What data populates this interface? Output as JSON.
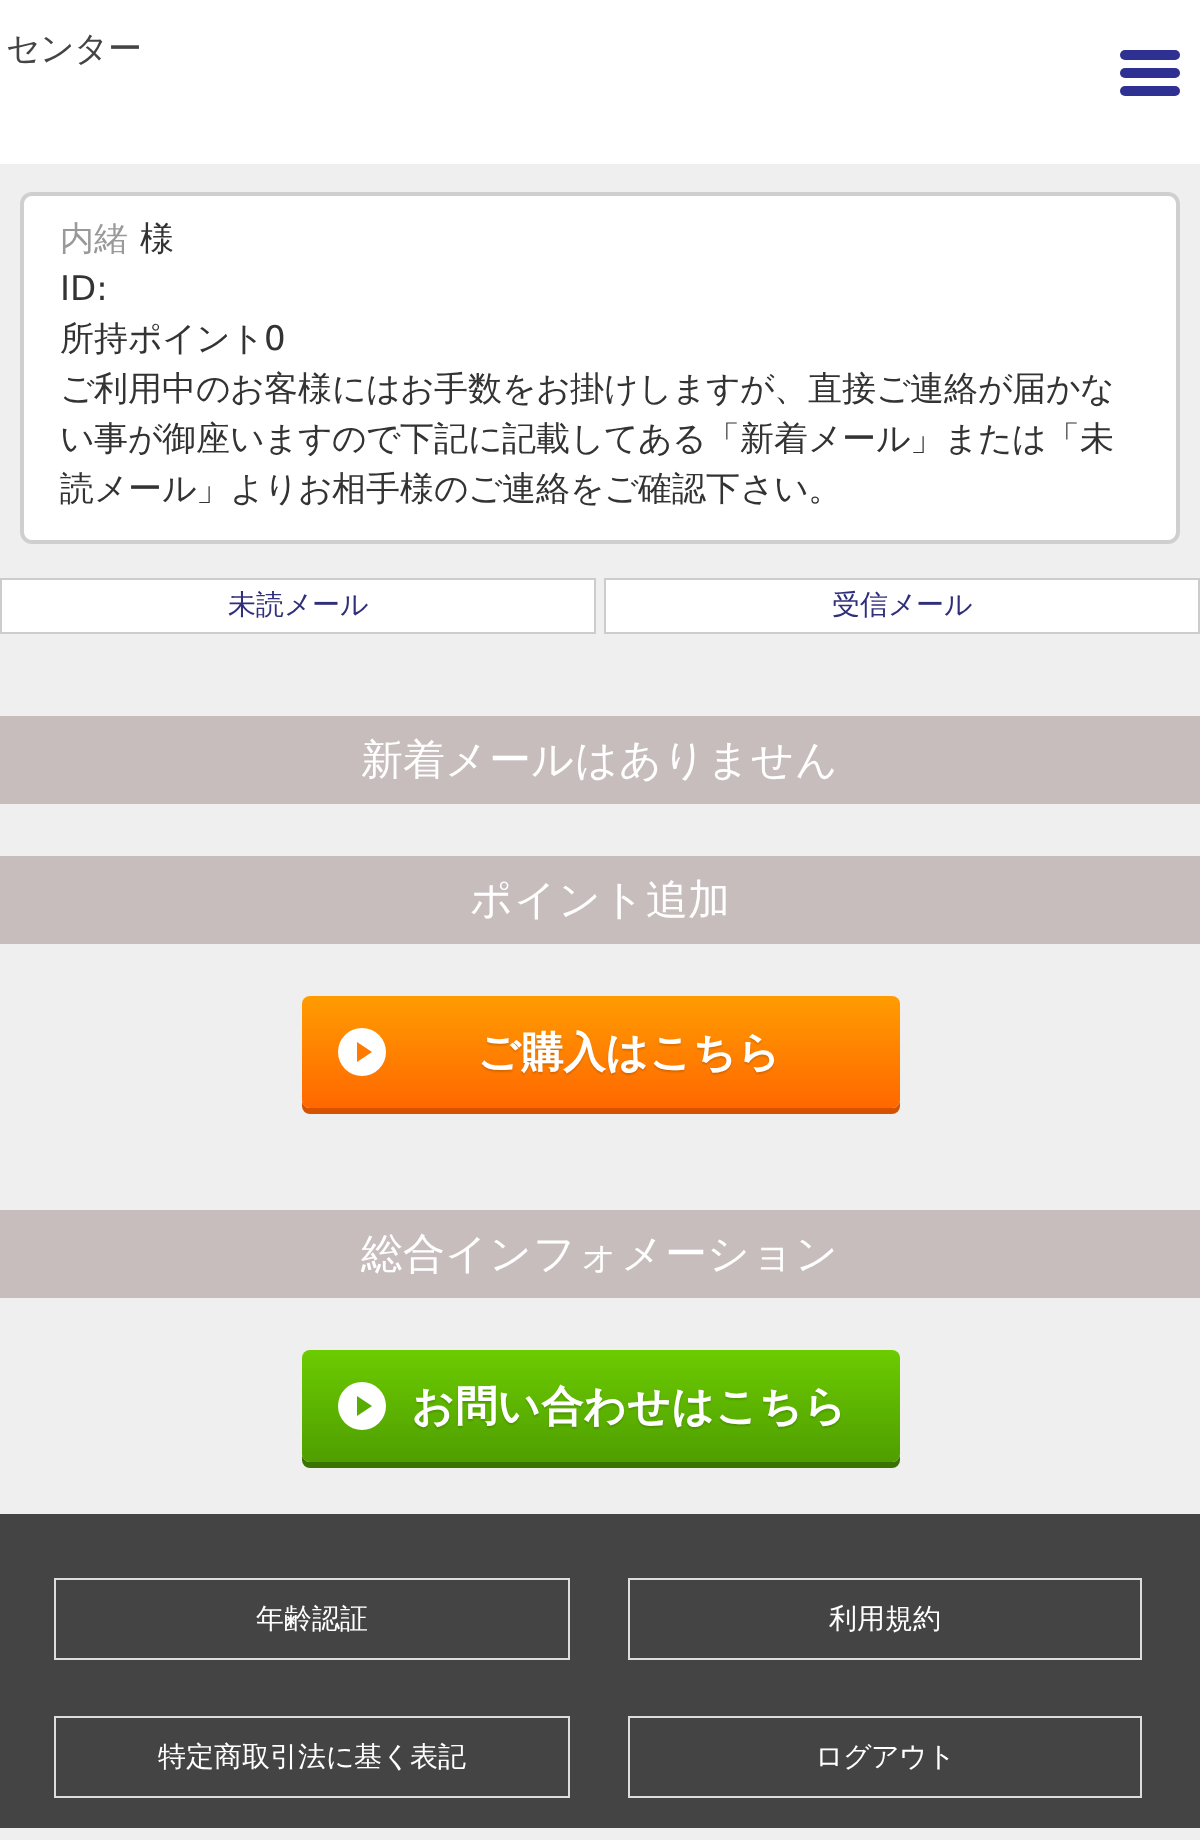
{
  "header": {
    "title": "センター"
  },
  "account": {
    "name": "内緒",
    "honorific": "様",
    "id_label": "ID:",
    "points": "所持ポイント0",
    "notice": "ご利用中のお客様にはお手数をお掛けしますが、直接ご連絡が届かない事が御座いますので下記に記載してある「新着メール」または「未読メール」よりお相手様のご連絡をご確認下さい。"
  },
  "mail_tabs": [
    {
      "label": "未読メール"
    },
    {
      "label": "受信メール"
    }
  ],
  "sections": [
    {
      "heading": "新着メールはありません"
    },
    {
      "heading": "ポイント追加",
      "button": {
        "kind": "purchase",
        "label": "ご購入はこちら"
      }
    },
    {
      "heading": "総合インフォメーション",
      "button": {
        "kind": "contact",
        "label": "お問い合わせはこちら"
      }
    }
  ],
  "footer_links": [
    {
      "label": "年齢認証"
    },
    {
      "label": "利用規約"
    },
    {
      "label": "特定商取引法に基く表記"
    },
    {
      "label": "ログアウト"
    }
  ]
}
